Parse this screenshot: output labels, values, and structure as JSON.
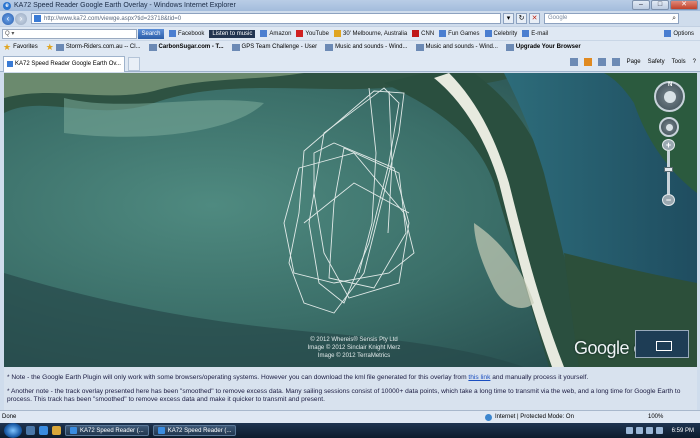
{
  "window": {
    "title": "KA72 Speed Reader Google Earth Overlay - Windows Internet Explorer"
  },
  "address": {
    "url": "http://www.ka72.com/viewge.aspx?tid=23718&tid=0"
  },
  "search": {
    "placeholder": "Google"
  },
  "links_bar": {
    "search_button": "Search",
    "items": [
      "Facebook",
      "Listen to music",
      "Amazon",
      "YouTube",
      "30' Melbourne, Australia",
      "CNN",
      "Fun Games",
      "Celebrity",
      "E-mail"
    ],
    "options": "Options"
  },
  "favorites": {
    "label": "Favorites",
    "items": [
      "Storm-Riders.com.au -- Cl...",
      "CarbonSugar.com - T...",
      "GPS Team Challenge - User",
      "Music and sounds - Wind...",
      "Music and sounds - Wind...",
      "Upgrade Your Browser"
    ]
  },
  "tab": {
    "label": "KA72 Speed Reader Google Earth Ov..."
  },
  "commandbar": {
    "page": "Page",
    "safety": "Safety",
    "tools": "Tools"
  },
  "map": {
    "copyright": [
      "© 2012 Whereis® Sensis Pty Ltd",
      "Image © 2012 Sinclair Knight Merz",
      "Image © 2012 TerraMetrics"
    ],
    "logo": "Google earth",
    "compass_north": "N"
  },
  "notes": {
    "note1_before": "* Note - the Google Earth Plugin will only work with some browsers/operating systems. However you can download the kml file generated for this overlay from ",
    "note1_link": "this link",
    "note1_after": " and manually process it yourself.",
    "note2": "* Another note - the track overlay presented here has been \"smoothed\" to remove excess data. Many sailing sessions consist of 10000+ data points, which take a long time to transmit via the web, and a long time for Google Earth to process. This track has been \"smoothed\" to remove excess data and make it quicker to transmit and present."
  },
  "status": {
    "left": "Done",
    "zone": "Internet | Protected Mode: On",
    "zoom": "100%"
  },
  "taskbar": {
    "items": [
      "KA72 Speed Reader (...",
      "KA72 Speed Reader (..."
    ],
    "clock": "6:59 PM"
  }
}
